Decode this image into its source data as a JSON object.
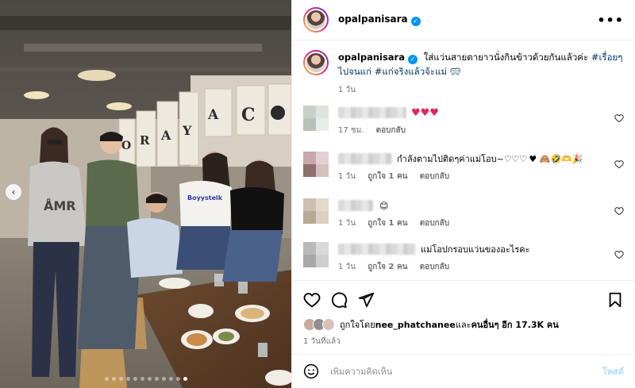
{
  "post": {
    "username": "opalpanisara",
    "more_icon": "•••",
    "photo": {
      "banner_letters": "ORAYA",
      "banner_letter_c": "C",
      "shirt_text_1": "AMR",
      "shirt_text_2": "Boyystelk",
      "dots_count": 12,
      "active_dot": 11
    },
    "caption": {
      "username": "opalpanisara",
      "text": "ใส่แว่นสายตายาวนั่งกินข้าวด้วยกันแล้วค่ะ ",
      "hashtags": "#เรื่อยๆไปจนแก่ #แก่จริงแล้วจ้ะแม่",
      "emoji": "🥽",
      "time": "1 วัน"
    },
    "comments": [
      {
        "text": "",
        "hearts": "♥♥♥",
        "time": "17 ชม.",
        "likes": "",
        "reply": "ตอบกลับ"
      },
      {
        "text": "กำลังตามไปติดๆค่าแม่โอบ~♡♡♡ ",
        "emojis": "♥ 🙈🤣🫶🎉",
        "time": "1 วัน",
        "likes": "ถูกใจ 1 คน",
        "reply": "ตอบกลับ"
      },
      {
        "text": "",
        "emojis": "😊",
        "time": "1 วัน",
        "likes": "ถูกใจ 1 คน",
        "reply": "ตอบกลับ"
      },
      {
        "text": "แม่โอปกรอบแว่นของอะไรคะ",
        "emojis": "",
        "time": "1 วัน",
        "likes": "ถูกใจ 2 คน",
        "reply": "ตอบกลับ"
      }
    ],
    "likes": {
      "prefix": "ถูกใจโดย ",
      "user": "nee_phatchanee",
      "middle": " และ",
      "others": "คนอื่นๆ อีก 17.3K คน"
    },
    "date": "1 วันที่แล้ว",
    "add_comment": {
      "placeholder": "เพิ่มความคิดเห็น",
      "post_label": "โพสต์"
    }
  },
  "colors": {
    "hashtag": "#00376b",
    "verified": "#0095f6",
    "post_disabled": "#b3dbff"
  }
}
